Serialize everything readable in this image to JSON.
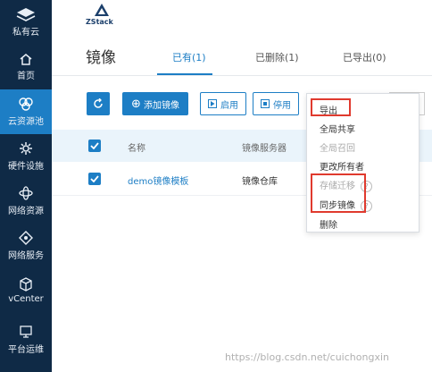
{
  "sidebar": {
    "items": [
      {
        "label": "私有云",
        "icon": "cloud-stack-icon"
      },
      {
        "label": "首页",
        "icon": "home-icon"
      },
      {
        "label": "云资源池",
        "icon": "cloud-pool-icon"
      },
      {
        "label": "硬件设施",
        "icon": "hardware-icon"
      },
      {
        "label": "网络资源",
        "icon": "network-icon"
      },
      {
        "label": "网络服务",
        "icon": "network-service-icon"
      },
      {
        "label": "vCenter",
        "icon": "cube-icon"
      },
      {
        "label": "平台运维",
        "icon": "monitor-icon"
      }
    ],
    "active_color": "#1d7ec5"
  },
  "header": {
    "logo_text": "ZStack",
    "page_title": "镜像"
  },
  "tabs": [
    {
      "label": "已有(1)"
    },
    {
      "label": "已删除(1)"
    },
    {
      "label": "已导出(0)"
    }
  ],
  "toolbar": {
    "add_label": "添加镜像",
    "start_label": "启用",
    "stop_label": "停用"
  },
  "table": {
    "headers": [
      "名称",
      "镜像服务器"
    ],
    "rows": [
      {
        "name": "demo镜像模板",
        "server": "镜像仓库"
      }
    ]
  },
  "menu": {
    "items": [
      {
        "label": "导出",
        "disabled": false
      },
      {
        "label": "全局共享",
        "disabled": false
      },
      {
        "label": "全局召回",
        "disabled": true
      },
      {
        "label": "更改所有者",
        "disabled": false
      },
      {
        "label": "存储迁移",
        "disabled": true
      },
      {
        "label": "同步镜像",
        "disabled": false
      },
      {
        "label": "删除",
        "disabled": false
      }
    ],
    "help_glyph": "?"
  },
  "watermark": "https://blog.csdn.net/cuichongxin"
}
